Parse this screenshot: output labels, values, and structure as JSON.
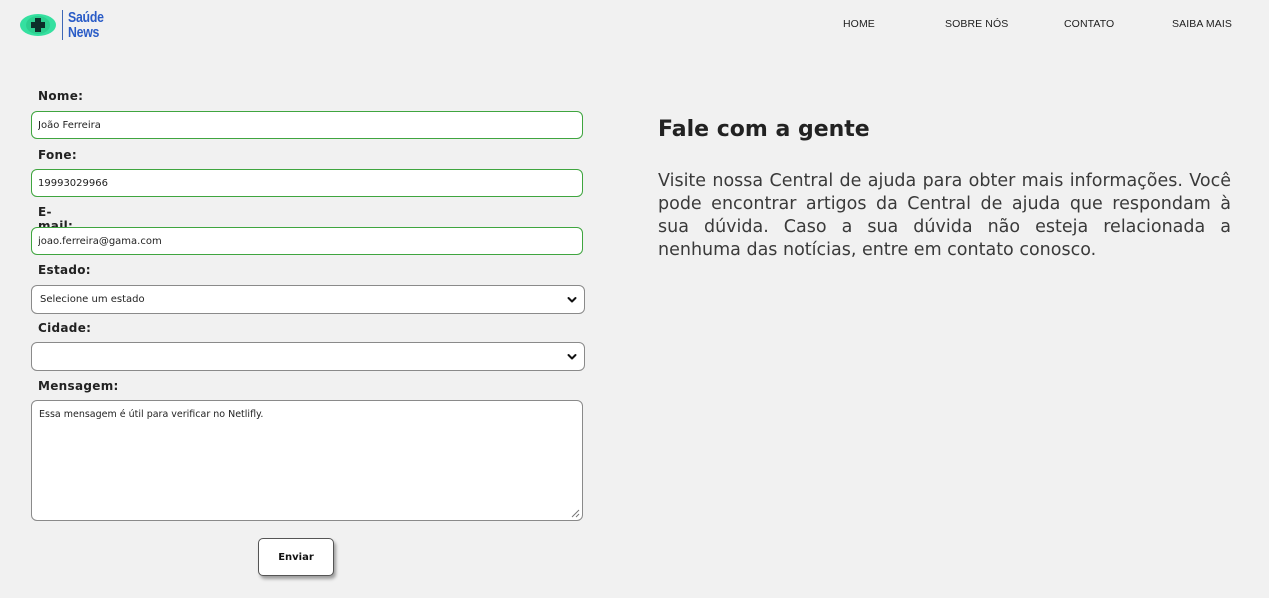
{
  "header": {
    "logo": {
      "icon": "health-cross-icon",
      "line1": "Saúde",
      "line2": "News",
      "colors": {
        "mark_outer": "#35e0a0",
        "mark_inner": "#0c2f2a",
        "text": "#2a5cc7"
      }
    },
    "nav": [
      {
        "label": "HOME"
      },
      {
        "label": "SOBRE NÓS"
      },
      {
        "label": "CONTATO"
      },
      {
        "label": "SAIBA MAIS"
      }
    ]
  },
  "form": {
    "nome": {
      "label": "Nome:",
      "value": "João Ferreira"
    },
    "fone": {
      "label": "Fone:",
      "value": "19993029966"
    },
    "email": {
      "label": "E-mail:",
      "value": "joao.ferreira@gama.com"
    },
    "estado": {
      "label": "Estado:",
      "selected": "Selecione um estado"
    },
    "cidade": {
      "label": "Cidade:",
      "selected": ""
    },
    "mensagem": {
      "label": "Mensagem:",
      "value": "Essa mensagem é útil para verificar no Netlifly."
    },
    "submit_label": "Enviar",
    "colors": {
      "input_border": "#3fa53f",
      "select_border": "#8a8a8a"
    }
  },
  "info": {
    "title": "Fale com a gente",
    "text": "Visite nossa Central de ajuda para obter mais informações. Você pode encontrar artigos da Central de ajuda que respondam à sua dúvida. Caso a sua dúvida não esteja relacionada a nenhuma das notícias, entre em contato conosco."
  }
}
